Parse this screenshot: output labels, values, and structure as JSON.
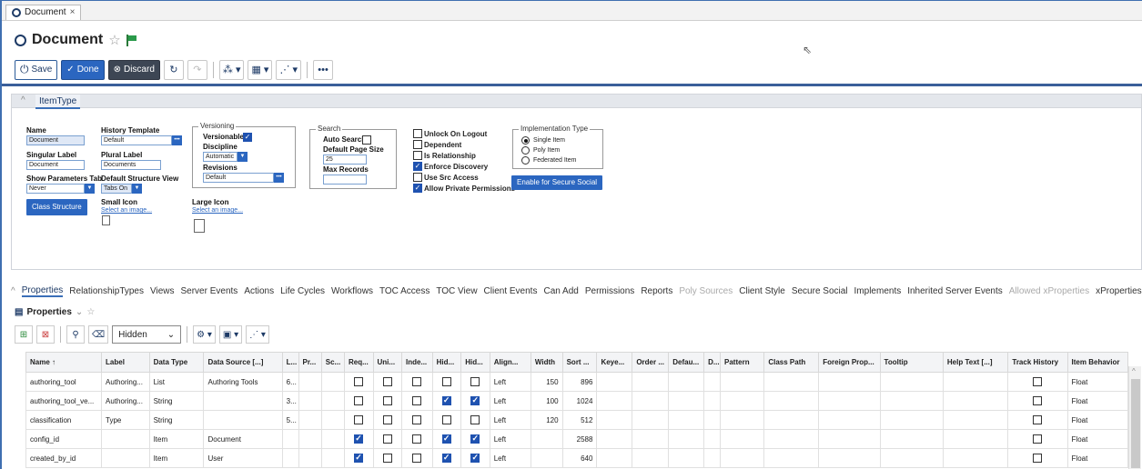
{
  "tab": {
    "label": "Document",
    "close": "×"
  },
  "header": {
    "title": "Document"
  },
  "toolbar": {
    "save": "Save",
    "done": "Done",
    "discard": "Discard",
    "more": "•••"
  },
  "section": {
    "tab": "ItemType"
  },
  "form": {
    "name_label": "Name",
    "name_value": "Document",
    "singular_label": "Singular Label",
    "singular_value": "Document",
    "show_params_label": "Show Parameters Tab",
    "show_params_value": "Never",
    "class_structure": "Class Structure",
    "history_label": "History Template",
    "history_value": "Default",
    "plural_label": "Plural Label",
    "plural_value": "Documents",
    "default_view_label": "Default Structure View",
    "default_view_value": "Tabs On",
    "small_icon_label": "Small Icon",
    "small_icon_link": "Select an image...",
    "large_icon_label": "Large Icon",
    "large_icon_link": "Select an image...",
    "versioning_legend": "Versioning",
    "versionable_label": "Versionable",
    "discipline_label": "Discipline",
    "discipline_value": "Automatic",
    "revisions_label": "Revisions",
    "revisions_value": "Default",
    "search_legend": "Search",
    "auto_search_label": "Auto Search",
    "page_size_label": "Default Page Size",
    "page_size_value": "25",
    "max_records_label": "Max Records",
    "unlock_label": "Unlock On Logout",
    "dependent_label": "Dependent",
    "relationship_label": "Is Relationship",
    "discovery_label": "Enforce Discovery",
    "src_access_label": "Use Src Access",
    "private_perm_label": "Allow Private Permissions",
    "impl_legend": "Implementation Type",
    "single_item": "Single Item",
    "poly_item": "Poly Item",
    "federated_item": "Federated Item",
    "secure_social_btn": "Enable for Secure Social"
  },
  "tabs": [
    {
      "label": "Properties",
      "state": "active"
    },
    {
      "label": "RelationshipTypes",
      "state": "normal"
    },
    {
      "label": "Views",
      "state": "normal"
    },
    {
      "label": "Server Events",
      "state": "normal"
    },
    {
      "label": "Actions",
      "state": "normal"
    },
    {
      "label": "Life Cycles",
      "state": "normal"
    },
    {
      "label": "Workflows",
      "state": "normal"
    },
    {
      "label": "TOC Access",
      "state": "normal"
    },
    {
      "label": "TOC View",
      "state": "normal"
    },
    {
      "label": "Client Events",
      "state": "normal"
    },
    {
      "label": "Can Add",
      "state": "normal"
    },
    {
      "label": "Permissions",
      "state": "normal"
    },
    {
      "label": "Reports",
      "state": "normal"
    },
    {
      "label": "Poly Sources",
      "state": "disabled"
    },
    {
      "label": "Client Style",
      "state": "normal"
    },
    {
      "label": "Secure Social",
      "state": "normal"
    },
    {
      "label": "Implements",
      "state": "normal"
    },
    {
      "label": "Inherited Server Events",
      "state": "normal"
    },
    {
      "label": "Allowed xProperties",
      "state": "disabled"
    },
    {
      "label": "xProperties",
      "state": "normal"
    }
  ],
  "props": {
    "title": "Properties",
    "filter": "Hidden"
  },
  "grid": {
    "columns": [
      "Name ↑",
      "Label",
      "Data Type",
      "Data Source [...]",
      "L...",
      "Pr...",
      "Sc...",
      "Req...",
      "Uni...",
      "Inde...",
      "Hid...",
      "Hid...",
      "Align...",
      "Width",
      "Sort ...",
      "Keye...",
      "Order ...",
      "Defau...",
      "D...",
      "Pattern",
      "Class Path",
      "Foreign Prop...",
      "Tooltip",
      "Help Text [...]",
      "Track History",
      "Item Behavior"
    ],
    "rows": [
      {
        "name": "authoring_tool",
        "label": "Authoring...",
        "type": "List",
        "source": "Authoring Tools",
        "len": "6...",
        "req": false,
        "uni": false,
        "idx": false,
        "hid1": false,
        "hid2": false,
        "align": "Left",
        "width": "150",
        "sort": "896",
        "track": false,
        "behavior": "Float"
      },
      {
        "name": "authoring_tool_ve...",
        "label": "Authoring...",
        "type": "String",
        "source": "",
        "len": "3...",
        "req": false,
        "uni": false,
        "idx": false,
        "hid1": true,
        "hid2": true,
        "align": "Left",
        "width": "100",
        "sort": "1024",
        "track": false,
        "behavior": "Float"
      },
      {
        "name": "classification",
        "label": "Type",
        "type": "String",
        "source": "",
        "len": "5...",
        "req": false,
        "uni": false,
        "idx": false,
        "hid1": false,
        "hid2": false,
        "align": "Left",
        "width": "120",
        "sort": "512",
        "track": false,
        "behavior": "Float"
      },
      {
        "name": "config_id",
        "label": "",
        "type": "Item",
        "source": "Document",
        "len": "",
        "req": true,
        "uni": false,
        "idx": false,
        "hid1": true,
        "hid2": true,
        "align": "Left",
        "width": "",
        "sort": "2588",
        "track": false,
        "behavior": "Float"
      },
      {
        "name": "created_by_id",
        "label": "",
        "type": "Item",
        "source": "User",
        "len": "",
        "req": true,
        "uni": false,
        "idx": false,
        "hid1": true,
        "hid2": true,
        "align": "Left",
        "width": "",
        "sort": "640",
        "track": false,
        "behavior": "Float"
      }
    ]
  }
}
